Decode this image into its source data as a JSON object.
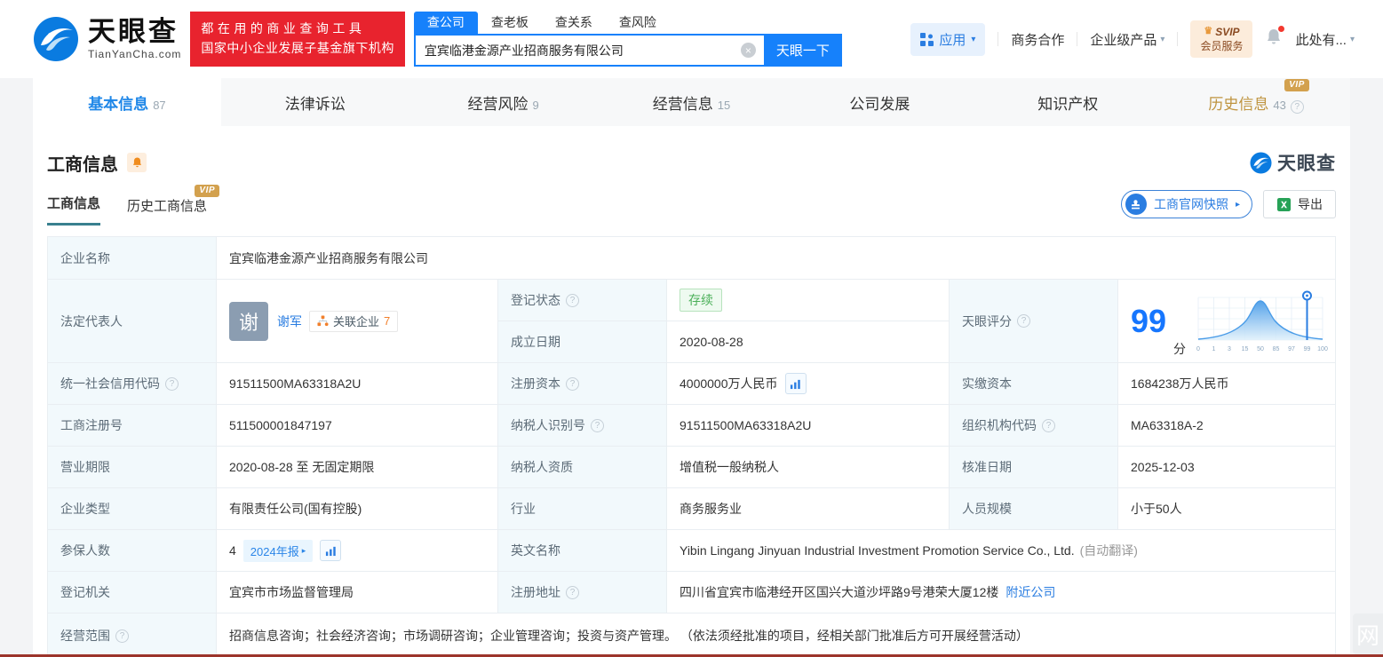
{
  "icons": {
    "caret_down": "▾",
    "arrow_right": "▸",
    "clear": "×",
    "crown": "♛",
    "question": "?",
    "watermark_glyph": "网"
  },
  "brand": {
    "name": "天眼查",
    "domain": "TianYanCha.com",
    "promo_line1": "都在用的商业查询工具",
    "promo_line2": "国家中小企业发展子基金旗下机构"
  },
  "search": {
    "tabs": [
      "查公司",
      "查老板",
      "查关系",
      "查风险"
    ],
    "value": "宜宾临港金源产业招商服务有限公司",
    "button": "天眼一下"
  },
  "topnav": {
    "apps": "应用",
    "cooperation": "商务合作",
    "enterprise": "企业级产品",
    "svip_top": "SVIP",
    "svip_bottom": "会员服务",
    "account": "此处有..."
  },
  "tabs": {
    "basic": {
      "label": "基本信息",
      "count": "87"
    },
    "legal": {
      "label": "法律诉讼",
      "count": ""
    },
    "risk": {
      "label": "经营风险",
      "count": "9"
    },
    "operating": {
      "label": "经营信息",
      "count": "15"
    },
    "development": {
      "label": "公司发展",
      "count": ""
    },
    "ip": {
      "label": "知识产权",
      "count": ""
    },
    "history": {
      "label": "历史信息",
      "count": "43",
      "vip": "VIP"
    }
  },
  "section": {
    "title": "工商信息",
    "subtab_current": "工商信息",
    "subtab_history": "历史工商信息",
    "vip": "VIP",
    "snapshot_button": "工商官网快照",
    "export_button": "导出",
    "watermark": "天眼查"
  },
  "score": {
    "label": "天眼评分",
    "value": "99",
    "unit": "分",
    "ticks": [
      "0",
      "1",
      "3",
      "15",
      "50",
      "85",
      "97",
      "99",
      "100"
    ]
  },
  "fields": {
    "company_name": {
      "label": "企业名称",
      "value": "宜宾临港金源产业招商服务有限公司"
    },
    "legal_rep": {
      "label": "法定代表人",
      "avatar": "谢",
      "name": "谢军",
      "related": "关联企业",
      "related_count": "7"
    },
    "reg_status": {
      "label": "登记状态",
      "value": "存续"
    },
    "establish_date": {
      "label": "成立日期",
      "value": "2020-08-28"
    },
    "credit_code": {
      "label": "统一社会信用代码",
      "value": "91511500MA63318A2U"
    },
    "reg_capital": {
      "label": "注册资本",
      "value": "4000000万人民币"
    },
    "paid_capital": {
      "label": "实缴资本",
      "value": "1684238万人民币"
    },
    "reg_number": {
      "label": "工商注册号",
      "value": "511500001847197"
    },
    "taxpayer_id": {
      "label": "纳税人识别号",
      "value": "91511500MA63318A2U"
    },
    "org_code": {
      "label": "组织机构代码",
      "value": "MA63318A-2"
    },
    "business_term": {
      "label": "营业期限",
      "value": "2020-08-28 至 无固定期限"
    },
    "taxpayer_quality": {
      "label": "纳税人资质",
      "value": "增值税一般纳税人"
    },
    "approval_date": {
      "label": "核准日期",
      "value": "2025-12-03"
    },
    "company_type": {
      "label": "企业类型",
      "value": "有限责任公司(国有控股)"
    },
    "industry": {
      "label": "行业",
      "value": "商务服务业"
    },
    "staff_size": {
      "label": "人员规模",
      "value": "小于50人"
    },
    "insured": {
      "label": "参保人数",
      "value": "4",
      "report": "2024年报"
    },
    "english_name": {
      "label": "英文名称",
      "value": "Yibin Lingang Jinyuan Industrial Investment Promotion Service Co., Ltd.",
      "note": "(自动翻译)"
    },
    "reg_authority": {
      "label": "登记机关",
      "value": "宜宾市市场监督管理局"
    },
    "reg_address": {
      "label": "注册地址",
      "value": "四川省宜宾市临港经开区国兴大道沙坪路9号港荣大厦12楼",
      "nearby": "附近公司"
    },
    "business_scope": {
      "label": "经营范围",
      "value": "招商信息咨询；社会经济咨询；市场调研咨询；企业管理咨询；投资与资产管理。 （依法须经批准的项目，经相关部门批准后方可开展经营活动）"
    }
  }
}
